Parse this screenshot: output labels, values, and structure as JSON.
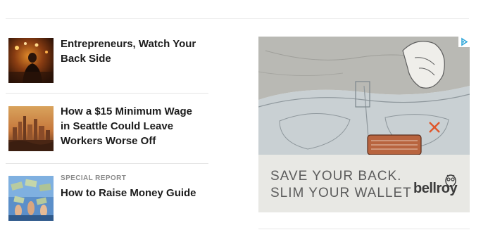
{
  "articles": [
    {
      "title_lines": [
        "Entrepreneurs, Watch Your",
        "Back Side"
      ],
      "kicker": ""
    },
    {
      "title_lines": [
        "How a $15 Minimum Wage",
        "in Seattle Could Leave",
        "Workers Worse Off"
      ],
      "kicker": ""
    },
    {
      "title_lines": [
        "How to Raise Money Guide"
      ],
      "kicker": "SPECIAL REPORT"
    }
  ],
  "ad": {
    "line1": "SAVE YOUR BACK.",
    "line2": "SLIM YOUR WALLET",
    "brand": "bellroy",
    "colors": {
      "background": "#e8e8e4",
      "jeans": "#c9d0d3",
      "shirt": "#b9b9b4",
      "wallet": "#b8643f",
      "mark": "#e0562a"
    }
  },
  "icons": {
    "ad_choices": "ad-choices-icon",
    "owl": "owl-logo-icon"
  }
}
